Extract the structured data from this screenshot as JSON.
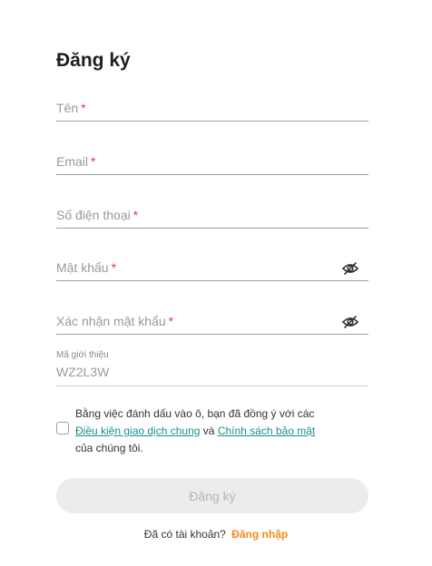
{
  "form": {
    "title": "Đăng ký",
    "required_mark": "*",
    "fields": {
      "name": {
        "placeholder": "Tên"
      },
      "email": {
        "placeholder": "Email"
      },
      "phone": {
        "placeholder": "Số điện thoại"
      },
      "password": {
        "placeholder": "Mật khẩu",
        "icon": "eye-off-icon"
      },
      "confirm_password": {
        "placeholder": "Xác nhận mật khẩu",
        "icon": "eye-off-icon"
      }
    },
    "referral": {
      "label": "Mã giới thiệu",
      "value": "WZ2L3W"
    },
    "agreement": {
      "text_before": "Bằng việc đánh dấu vào ô, bạn đã đồng ý với các",
      "terms_link": "Điều kiện giao dịch chung",
      "connector": "và",
      "privacy_link": "Chính sách bảo mật",
      "text_after": "của chúng tôi.",
      "checked": false
    },
    "submit_label": "Đăng ký",
    "login_prompt": "Đã có tài khoản?",
    "login_link": "Đăng nhập"
  },
  "colors": {
    "required": "#e53935",
    "link": "#1a8f8f",
    "login_link": "#f28c1a",
    "button_disabled_bg": "#ececec"
  }
}
